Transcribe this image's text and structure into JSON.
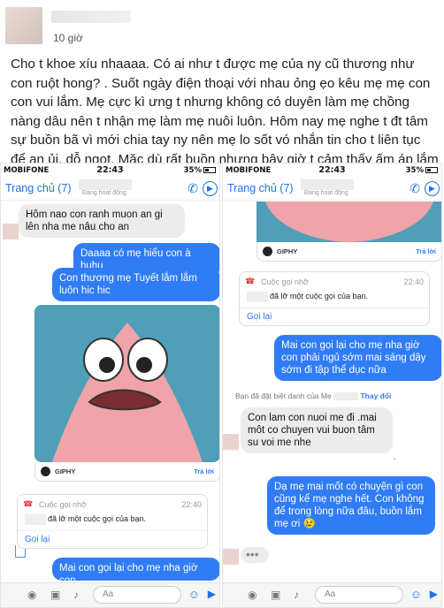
{
  "post": {
    "time": "10 giờ",
    "text": "Cho t khoe xíu nhaaaa. Có ai như t được mẹ của ny cũ thương như con ruột hong? . Suốt ngày điện thoại với nhau ỏng ẹo kêu mẹ mẹ con con vui lắm. Mẹ cực kì ưng t nhưng không có duyên làm mẹ chồng nàng dâu nên t nhận mẹ làm mẹ nuôi luôn. Hôm nay mẹ nghe t đt tâm sự buồn bã vì mới chia tay ny nên mẹ lo sốt vó nhắn tin cho t liên tục để an ủi, dỗ ngọt. Mặc dù rất buồn nhưng bây giờ t cảm thấy ấm áp lắm lắm luôn ý hehe"
  },
  "colors": {
    "accent": "#2f7cf6",
    "bubble_in": "#ececec",
    "gif_bg": "#4f9fb8",
    "patrick": "#f0a3a8"
  },
  "left": {
    "status": {
      "carrier": "MOBIFONE",
      "clock": "22:43",
      "battery": "35%"
    },
    "nav": {
      "back": "Trang chủ (7)",
      "active": "Đang hoạt động"
    },
    "msgs": [
      "Hôm nao con ranh muon an gi lên nha me nâu cho an",
      "Daaaa có mẹ hiểu con à huhu",
      "Con thương mẹ Tuyết lắm lắm luôn hic hic"
    ],
    "gif": {
      "brand": "GIPHY",
      "reply": "Trả lời"
    },
    "call": {
      "title": "Cuộc gọi nhỡ",
      "time": "22:40",
      "text": "đã lỡ một cuộc gọi của bạn.",
      "recall": "Gọi lại"
    },
    "last": "Mai con gọi lại cho mẹ nha giờ con",
    "composer": {
      "placeholder": "Aa"
    }
  },
  "right": {
    "status": {
      "carrier": "MOBIFONE",
      "clock": "22:43",
      "battery": "35%"
    },
    "nav": {
      "back": "Trang chủ (7)",
      "active": "Đang hoạt động"
    },
    "gif": {
      "brand": "GIPHY",
      "reply": "Trả lời"
    },
    "call": {
      "title": "Cuộc gọi nhỡ",
      "time": "22:40",
      "text": "đã lỡ một cuộc gọi của bạn.",
      "recall": "Gọi lại"
    },
    "msg1": "Mai con gọi lại cho mẹ nha giờ con phải ngủ sớm mai sáng dậy sớm đi tập thể dục nữa",
    "changed_prefix": "Bạn đã đặt biệt danh của Mẹ",
    "changed_action": "Thay đổi",
    "msg2": "Con lam con nuoi me đi .mai môt co chuyen vui buon tâm su voi me nhe",
    "msg3": "Dạ mẹ mai mốt có chuyện gì con cũng kể mẹ nghe hết. Con không để trong lòng nữa đâu, buồn lắm mẹ ơi 😢",
    "typing": "•••",
    "composer": {
      "placeholder": "Aa"
    }
  }
}
